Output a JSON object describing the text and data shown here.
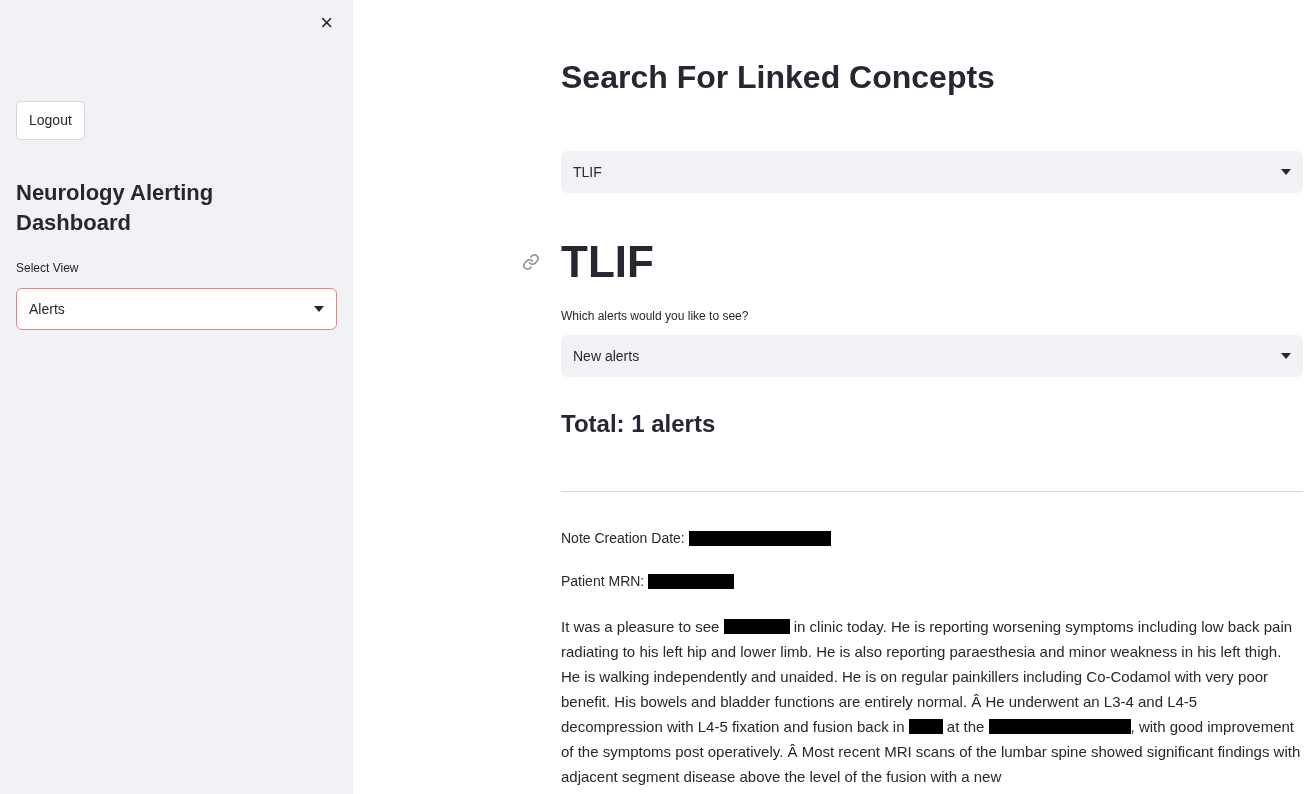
{
  "sidebar": {
    "close": "×",
    "logout": "Logout",
    "title": "Neurology Alerting Dashboard",
    "view_select": {
      "label": "Select View",
      "value": "Alerts",
      "focused": true
    }
  },
  "main": {
    "title": "Search For Linked Concepts",
    "concept_select": {
      "value": "TLIF"
    },
    "concept_heading": "TLIF",
    "alerts_select": {
      "label": "Which alerts would you like to see?",
      "value": "New alerts"
    },
    "total": "Total: 1 alerts",
    "note": {
      "fields": [
        {
          "label": "Note Creation Date:",
          "kind": "redacted"
        },
        {
          "label": "Patient MRN:",
          "kind": "redacted"
        }
      ],
      "body": [
        {
          "kind": "text",
          "text": "It was a pleasure to see "
        },
        {
          "kind": "redacted"
        },
        {
          "kind": "text",
          "text": " in clinic today. He is reporting worsening symptoms including low back pain radiating to his left hip and lower limb. He is also reporting paraesthesia and minor weakness in his left thigh. He is walking independently and unaided. He is on regular painkillers including Co-Codamol with very poor benefit. His bowels and bladder functions are entirely normal. Â He underwent an L3-4 and L4-5 decompression with L4-5 fixation and fusion back in "
        },
        {
          "kind": "redacted"
        },
        {
          "kind": "text",
          "text": " at the "
        },
        {
          "kind": "redacted"
        },
        {
          "kind": "text",
          "text": ", with good improvement of the symptoms post operatively. Â Most recent MRI scans of the lumbar spine showed significant findings with adjacent segment disease above the level of the fusion with a new"
        }
      ]
    }
  }
}
